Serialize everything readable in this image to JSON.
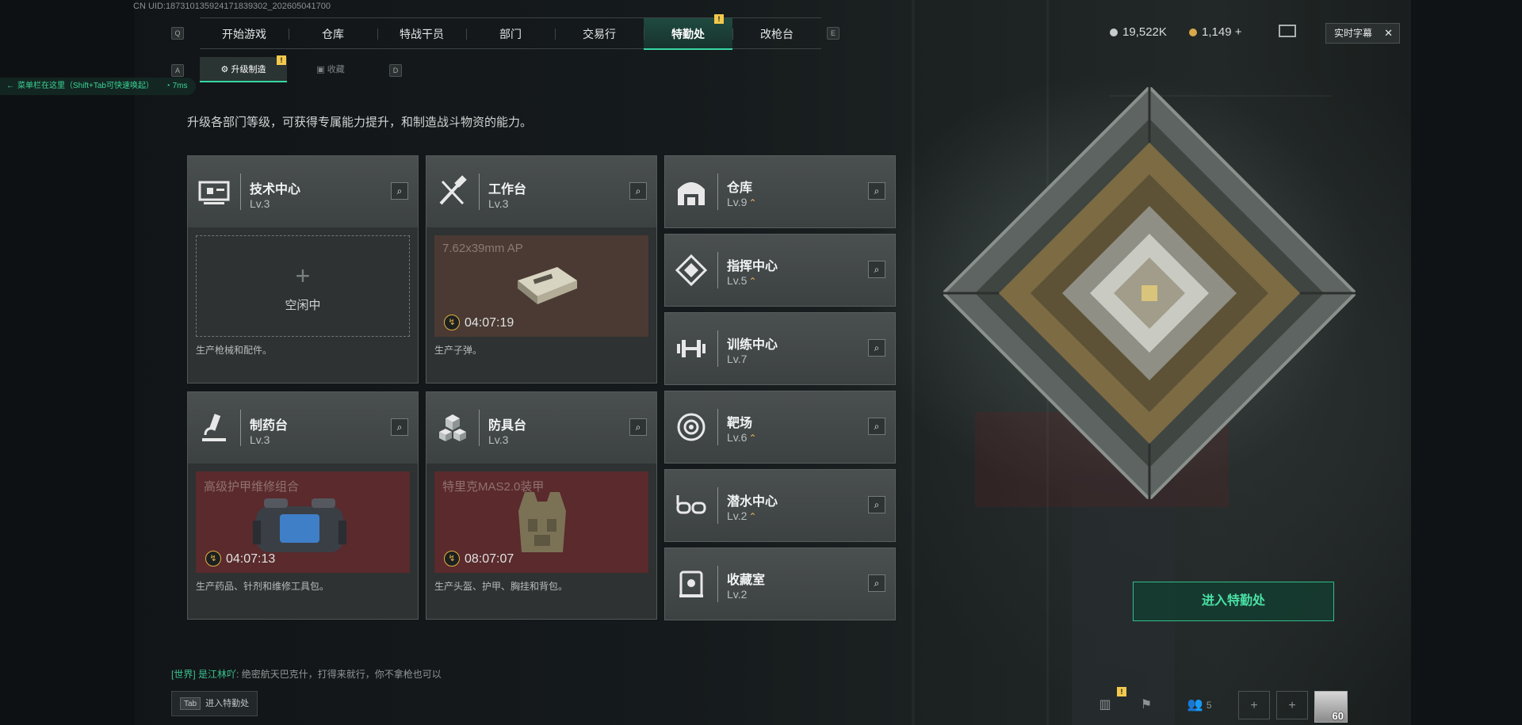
{
  "uid": "CN UID:187310135924171839302_202605041700",
  "nav": {
    "key_left": "Q",
    "key_right": "E",
    "tabs": [
      {
        "label": "开始游戏"
      },
      {
        "label": "仓库"
      },
      {
        "label": "特战干员"
      },
      {
        "label": "部门"
      },
      {
        "label": "交易行"
      },
      {
        "label": "特勤处",
        "active": true,
        "badge": "!"
      },
      {
        "label": "改枪台"
      }
    ]
  },
  "subnav": {
    "key_left": "A",
    "key_right": "D",
    "tabs": [
      {
        "label": "升级制造",
        "active": true,
        "badge": "!"
      },
      {
        "label": "收藏"
      }
    ]
  },
  "menu_hint": {
    "text": "菜单栏在这里（Shift+Tab可快速唤起）",
    "ping": "7ms"
  },
  "description": "升级各部门等级，可获得专属能力提升，和制造战斗物资的能力。",
  "production_cards": [
    {
      "name": "技术中心",
      "level": "Lv.3",
      "status": "idle",
      "idle_text": "空闲中",
      "desc": "生产枪械和配件。",
      "icon": "computer-icon"
    },
    {
      "name": "工作台",
      "level": "Lv.3",
      "status": "producing",
      "item": "7.62x39mm AP",
      "timer": "04:07:19",
      "desc": "生产子弹。",
      "icon": "tools-icon",
      "color": "#4b3a33"
    },
    {
      "name": "制药台",
      "level": "Lv.3",
      "status": "producing",
      "item": "高级护甲维修组合",
      "timer": "04:07:13",
      "desc": "生产药品、针剂和维修工具包。",
      "icon": "microscope-icon",
      "color": "#5a2a2c"
    },
    {
      "name": "防具台",
      "level": "Lv.3",
      "status": "producing",
      "item": "特里克MAS2.0装甲",
      "timer": "08:07:07",
      "desc": "生产头盔、护甲、胸挂和背包。",
      "icon": "cubes-icon",
      "color": "#5a2a2c"
    }
  ],
  "departments": [
    {
      "name": "仓库",
      "level": "Lv.9",
      "upgradable": true,
      "icon": "warehouse-icon"
    },
    {
      "name": "指挥中心",
      "level": "Lv.5",
      "upgradable": true,
      "icon": "command-icon"
    },
    {
      "name": "训练中心",
      "level": "Lv.7",
      "upgradable": false,
      "icon": "dumbbell-icon"
    },
    {
      "name": "靶场",
      "level": "Lv.6",
      "upgradable": true,
      "icon": "target-icon"
    },
    {
      "name": "潜水中心",
      "level": "Lv.2",
      "upgradable": true,
      "icon": "goggles-icon"
    },
    {
      "name": "收藏室",
      "level": "Lv.2",
      "upgradable": false,
      "icon": "display-case-icon"
    }
  ],
  "up_arrow": "⌃",
  "enter_button": "进入特勤处",
  "currency": {
    "silver": "19,522K",
    "gold": "1,149",
    "gold_plus": "+"
  },
  "subtitle_toggle": {
    "label": "实时字幕",
    "close": "✕"
  },
  "chat": {
    "channel": "[世界]",
    "user": "是江林吖",
    "message": ": 绝密航天巴克什，打得来就行，你不拿枪也可以"
  },
  "tab_hint": {
    "key": "Tab",
    "label": "进入特勤处"
  },
  "bottom_bar": {
    "badge": "!",
    "friends": "5",
    "level": "60"
  },
  "colors": {
    "accent": "#36d7a2",
    "badge": "#f2c94c",
    "upgrade": "#e5b55c"
  }
}
